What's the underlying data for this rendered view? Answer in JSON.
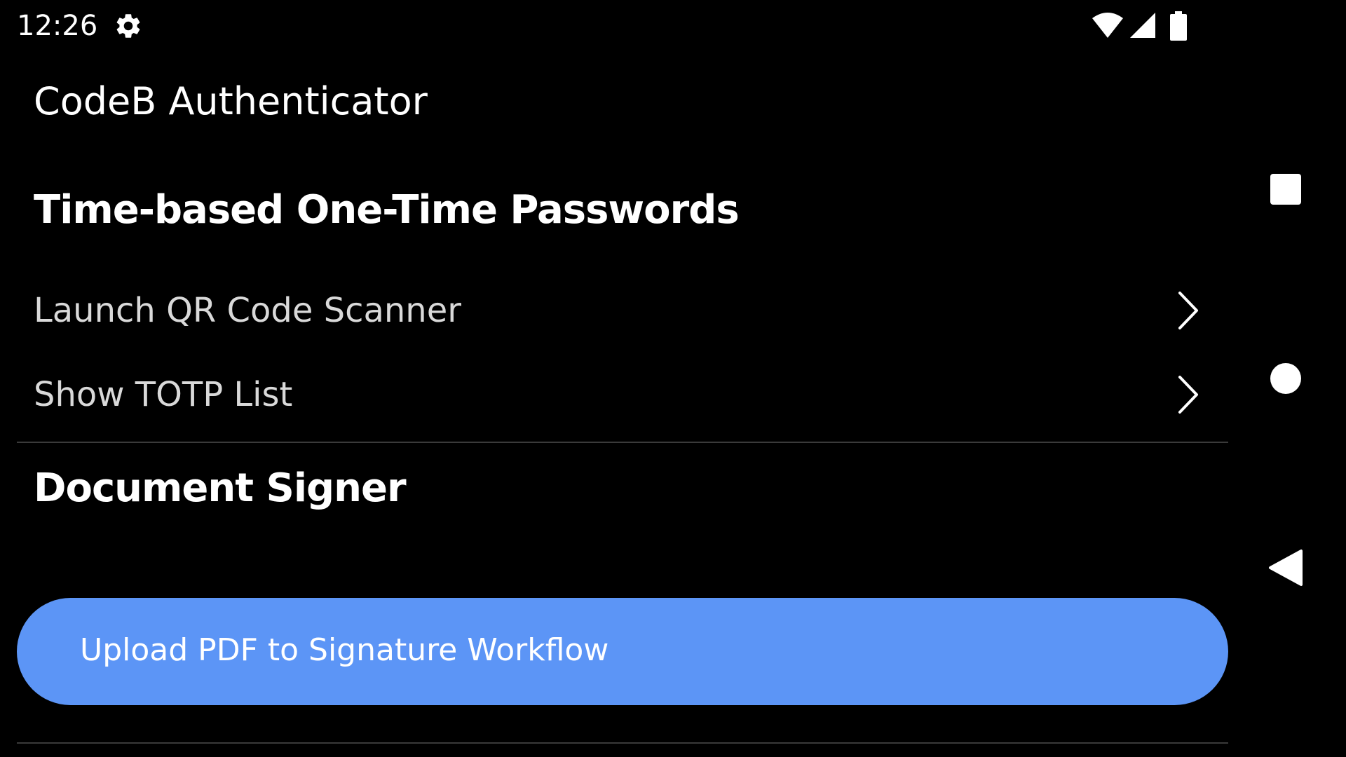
{
  "status_bar": {
    "time": "12:26",
    "icons": [
      "gear-icon",
      "wifi-icon",
      "cell-signal-icon",
      "battery-icon"
    ]
  },
  "app": {
    "title": "CodeB Authenticator"
  },
  "totp_section": {
    "title": "Time-based One-Time Passwords",
    "items": [
      {
        "label": "Launch QR Code Scanner",
        "icon": "chevron-right-icon"
      },
      {
        "label": "Show TOTP List",
        "icon": "chevron-right-icon"
      }
    ]
  },
  "signer_section": {
    "title": "Document Signer",
    "upload_button_label": "Upload PDF to Signature Workflow"
  },
  "nav_bar": {
    "buttons": [
      "recents-icon",
      "home-icon",
      "back-icon"
    ]
  },
  "colors": {
    "background": "#000000",
    "accent": "#5c95f6",
    "text_primary": "#ffffff",
    "text_secondary": "#d9d9d9",
    "divider": "#3a3a3a"
  }
}
